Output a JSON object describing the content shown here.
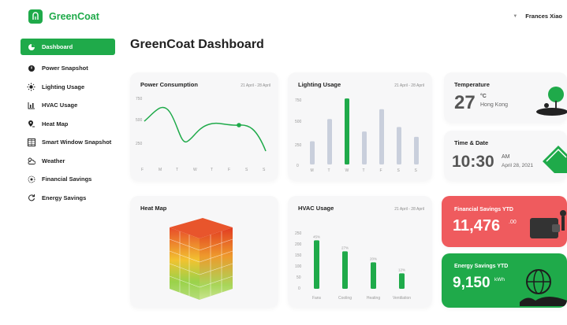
{
  "app": {
    "name": "GreenCoat"
  },
  "user": {
    "name": "Frances Xiao"
  },
  "page": {
    "title": "GreenCoat Dashboard"
  },
  "sidebar": {
    "items": [
      {
        "label": "Dashboard",
        "icon": "pie-chart-icon",
        "active": true
      },
      {
        "label": "Power Snapshot",
        "icon": "power-icon"
      },
      {
        "label": "Lighting Usage",
        "icon": "sun-icon"
      },
      {
        "label": "HVAC Usage",
        "icon": "bar-chart-icon"
      },
      {
        "label": "Heat Map",
        "icon": "map-pin-icon"
      },
      {
        "label": "Smart Window Snapshot",
        "icon": "window-icon"
      },
      {
        "label": "Weather",
        "icon": "cloud-sun-icon"
      },
      {
        "label": "Financial Savings",
        "icon": "coin-icon"
      },
      {
        "label": "Energy Savings",
        "icon": "refresh-icon"
      }
    ]
  },
  "power": {
    "title": "Power Consumption",
    "date": "21 April - 28 April",
    "yticks": [
      "750",
      "500",
      "250"
    ],
    "days": [
      "F",
      "M",
      "T",
      "W",
      "T",
      "F",
      "S",
      "S"
    ]
  },
  "lighting": {
    "title": "Lighting Usage",
    "date": "21 April - 28 April",
    "yticks": [
      "750",
      "500",
      "250",
      "0"
    ],
    "days": [
      "M",
      "T",
      "W",
      "T",
      "F",
      "S",
      "S"
    ],
    "values": [
      260,
      510,
      740,
      370,
      620,
      420,
      310
    ],
    "highlight_index": 2
  },
  "temperature": {
    "title": "Temperature",
    "value": "27",
    "unit": "°C",
    "location": "Hong Kong"
  },
  "time": {
    "title": "Time & Date",
    "value": "10:30",
    "ampm": "AM",
    "date": "April 28, 2021"
  },
  "heatmap": {
    "title": "Heat Map"
  },
  "hvac": {
    "title": "HVAC Usage",
    "date": "21 April - 28 April",
    "yticks": [
      "250",
      "200",
      "150",
      "100",
      "50",
      "0"
    ],
    "categories": [
      "Fans",
      "Cooling",
      "Heating",
      "Ventilation"
    ],
    "percents": [
      "45%",
      "27%",
      "20%",
      "12%"
    ],
    "values": [
      220,
      170,
      120,
      70
    ]
  },
  "financial": {
    "title": "Financial Savings YTD",
    "value": "11,476",
    "cents": ".00"
  },
  "energy": {
    "title": "Energy Savings YTD",
    "value": "9,150",
    "unit": "kWh"
  },
  "colors": {
    "brand": "#1faa4a",
    "accent_red": "#ef5b5e",
    "bar_gray": "#c9cfdc"
  }
}
